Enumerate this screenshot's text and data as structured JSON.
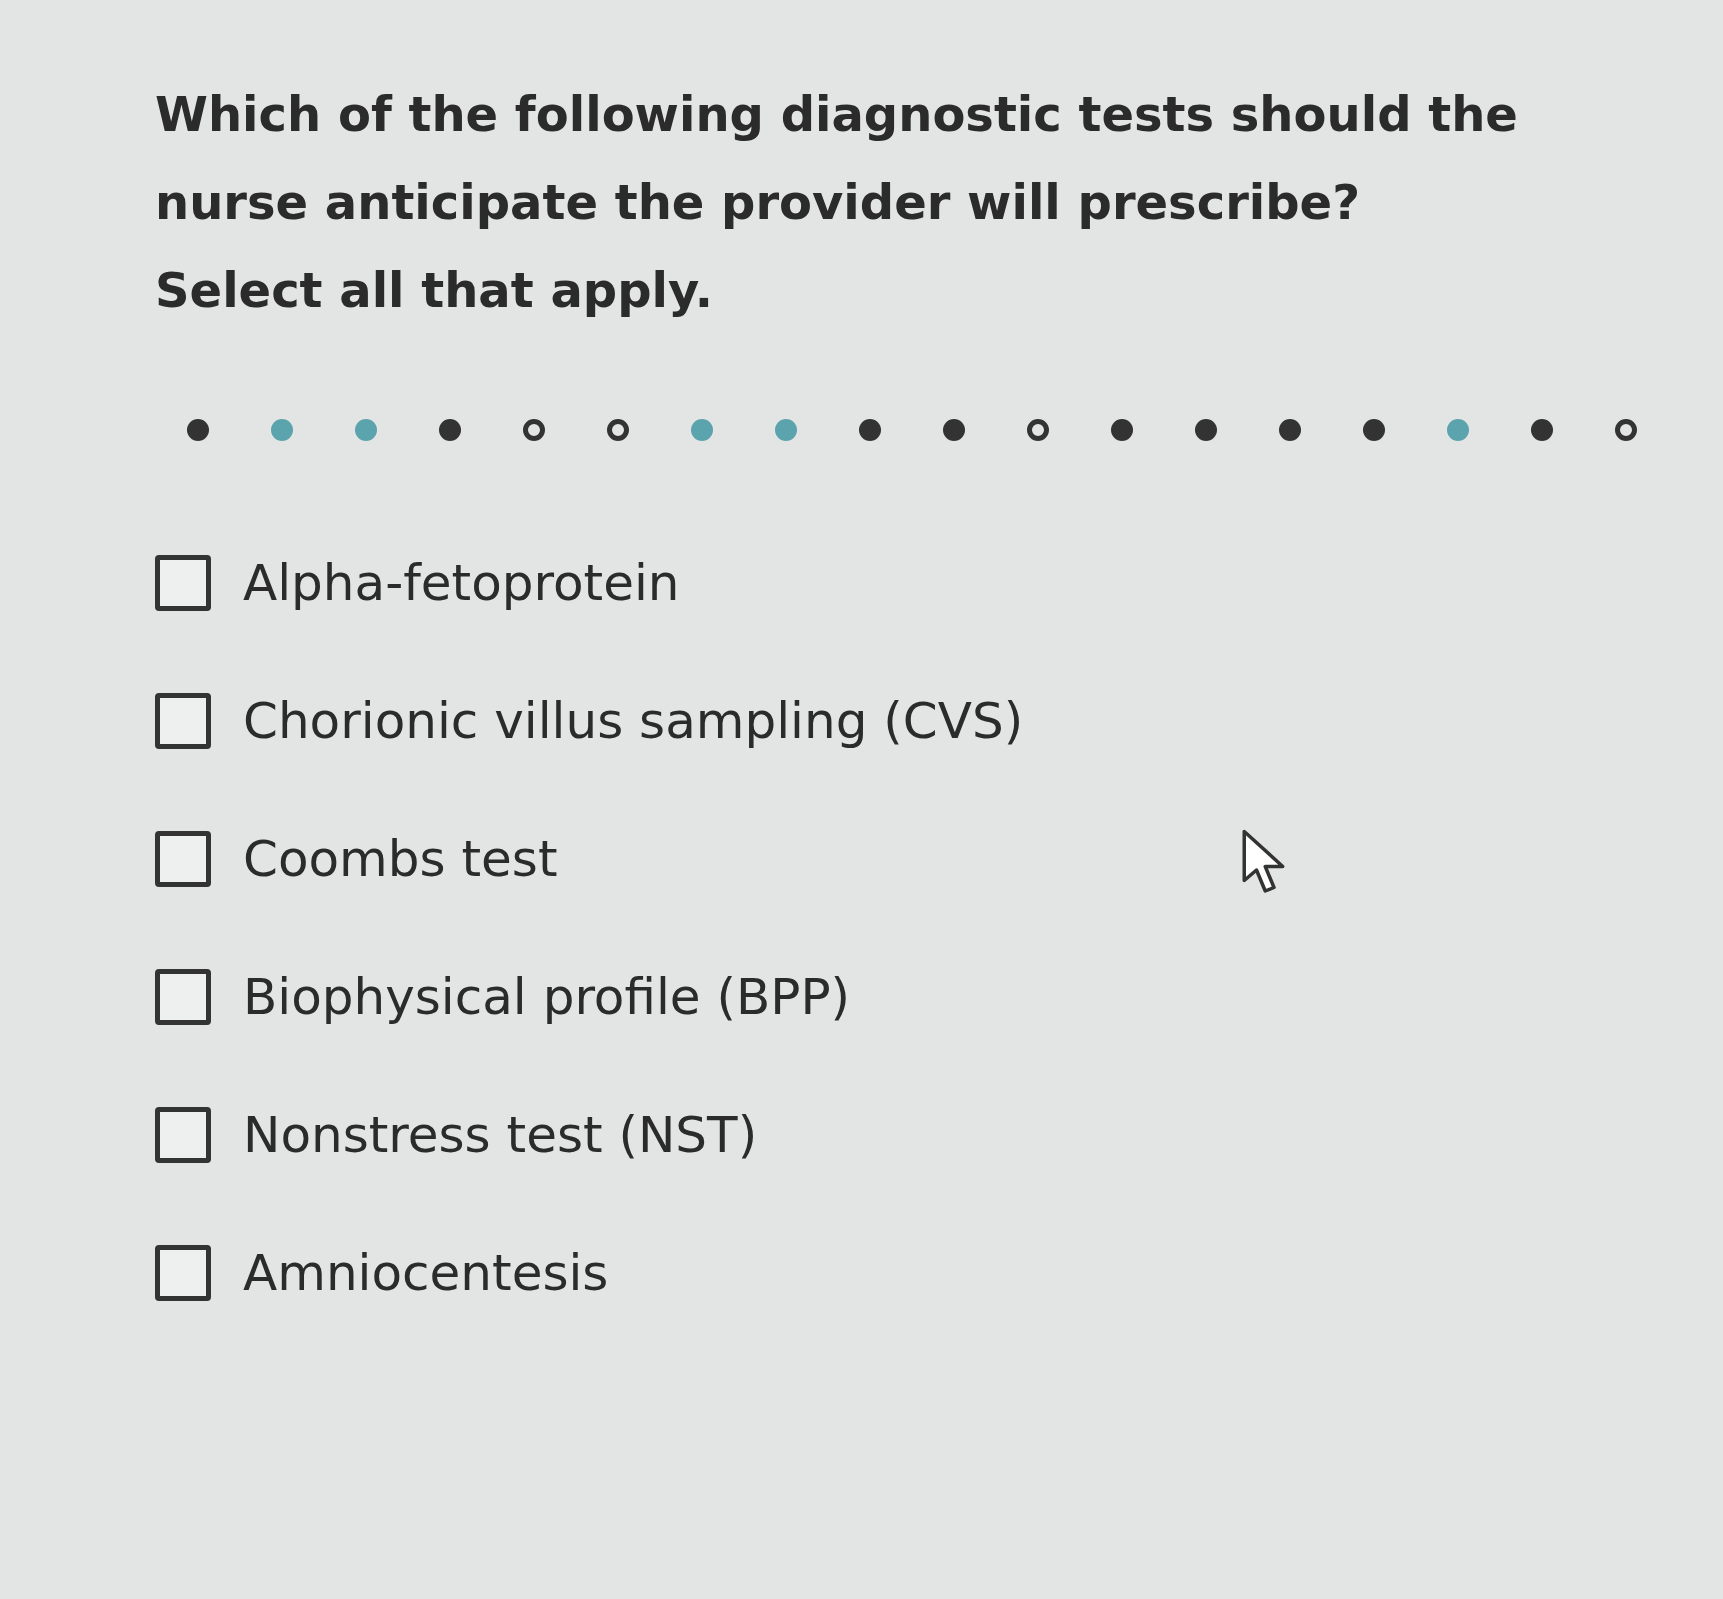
{
  "question": {
    "lines": [
      "Which of the following diagnostic tests should the nurse anticipate the provider will prescribe?",
      "Select all that apply."
    ]
  },
  "progress_dots": [
    {
      "kind": "filled",
      "color": "#333333"
    },
    {
      "kind": "filled",
      "color": "#5ba3ad"
    },
    {
      "kind": "filled",
      "color": "#5ba3ad"
    },
    {
      "kind": "filled",
      "color": "#333333"
    },
    {
      "kind": "outline",
      "color": "#333333"
    },
    {
      "kind": "outline",
      "color": "#333333"
    },
    {
      "kind": "filled",
      "color": "#5ba3ad"
    },
    {
      "kind": "filled",
      "color": "#5ba3ad"
    },
    {
      "kind": "filled",
      "color": "#333333"
    },
    {
      "kind": "filled",
      "color": "#333333"
    },
    {
      "kind": "outline",
      "color": "#333333"
    },
    {
      "kind": "filled",
      "color": "#333333"
    },
    {
      "kind": "filled",
      "color": "#333333"
    },
    {
      "kind": "filled",
      "color": "#333333"
    },
    {
      "kind": "filled",
      "color": "#333333"
    },
    {
      "kind": "filled",
      "color": "#5ba3ad"
    },
    {
      "kind": "filled",
      "color": "#333333"
    },
    {
      "kind": "outline",
      "color": "#333333"
    }
  ],
  "options": [
    {
      "label": "Alpha-fetoprotein",
      "checked": false
    },
    {
      "label": "Chorionic villus sampling (CVS)",
      "checked": false
    },
    {
      "label": "Coombs test",
      "checked": false
    },
    {
      "label": "Biophysical profile (BPP)",
      "checked": false
    },
    {
      "label": "Nonstress test (NST)",
      "checked": false
    },
    {
      "label": "Amniocentesis",
      "checked": false
    }
  ]
}
